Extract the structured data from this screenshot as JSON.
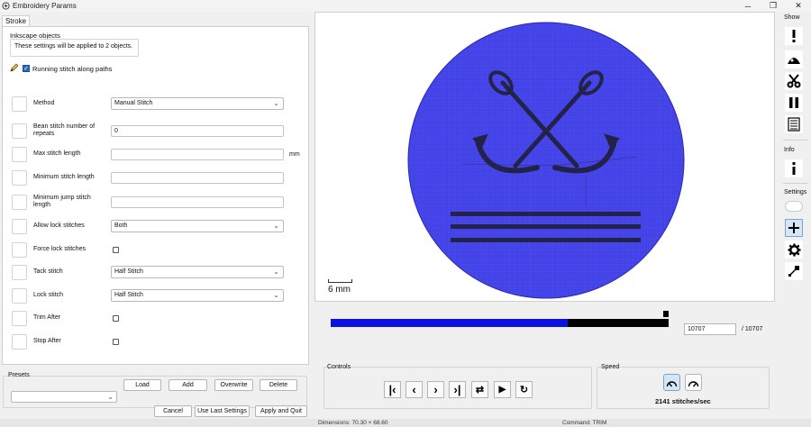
{
  "window": {
    "title": "Embroidery Params",
    "minimize": "─",
    "maximize": "❐",
    "close": "✕"
  },
  "tabs": [
    "Stroke"
  ],
  "inkscape_group": {
    "title": "Inkscape objects",
    "message": "These settings will be applied to 2 objects."
  },
  "running_stitch": {
    "label": "Running stitch along paths",
    "checked": true
  },
  "params": [
    {
      "label": "Method",
      "type": "select",
      "value": "Manual Stitch"
    },
    {
      "label": "Bean stitch number of repeats",
      "type": "text",
      "value": "0"
    },
    {
      "label": "Max stitch length",
      "type": "text",
      "value": "",
      "unit": "mm"
    },
    {
      "label": "Minimum stitch length",
      "type": "text",
      "value": ""
    },
    {
      "label": "Minimum jump stitch length",
      "type": "text",
      "value": ""
    },
    {
      "label": "Allow lock stitches",
      "type": "select",
      "value": "Both"
    },
    {
      "label": "Force lock stitches",
      "type": "checkbox",
      "checked": false
    },
    {
      "label": "Tack stitch",
      "type": "select",
      "value": "Half Stitch"
    },
    {
      "label": "Lock stitch",
      "type": "select",
      "value": "Half Stitch"
    },
    {
      "label": "Trim After",
      "type": "checkbox",
      "checked": false
    },
    {
      "label": "Stop After",
      "type": "checkbox",
      "checked": false
    }
  ],
  "presets": {
    "label": "Presets",
    "selected": "",
    "buttons": [
      "Load",
      "Add",
      "Overwrite",
      "Delete"
    ]
  },
  "footer_buttons": [
    "Cancel",
    "Use Last Settings",
    "Apply and Quit"
  ],
  "status": {
    "dimensions": "Dimensions: 70.30 × 68.60",
    "command": "Command: TRIM"
  },
  "preview": {
    "scale_label": "6 mm",
    "fill_color": "#4a4af0",
    "stitch_color": "#23234a"
  },
  "player": {
    "progress_fraction": 0.7,
    "current_stitch": "10707",
    "total_stitches": "/ 10707",
    "controls_label": "Controls",
    "speed_label": "Speed",
    "speed_text": "2141 stitches/sec",
    "control_buttons": [
      {
        "name": "first-stitch-button",
        "icon": "skip-first-icon"
      },
      {
        "name": "previous-stitch-button",
        "icon": "chevron-left-icon"
      },
      {
        "name": "next-stitch-button",
        "icon": "chevron-right-icon"
      },
      {
        "name": "last-stitch-button",
        "icon": "skip-last-icon"
      },
      {
        "name": "direction-button",
        "icon": "swap-arrows-icon"
      },
      {
        "name": "play-button",
        "icon": "play-icon"
      },
      {
        "name": "restart-button",
        "icon": "refresh-icon"
      }
    ]
  },
  "sidebar": {
    "show_label": "Show",
    "info_label": "Info",
    "settings_label": "Settings",
    "show_buttons": [
      "warning-icon",
      "jump-icon",
      "scissors-icon",
      "pause-icon",
      "text-list-icon"
    ],
    "settings_buttons": [
      "plus-icon",
      "gear-icon",
      "resize-icon"
    ]
  },
  "colors": {
    "progress_fill": "#0a12e0",
    "accent": "#2a66c8"
  }
}
